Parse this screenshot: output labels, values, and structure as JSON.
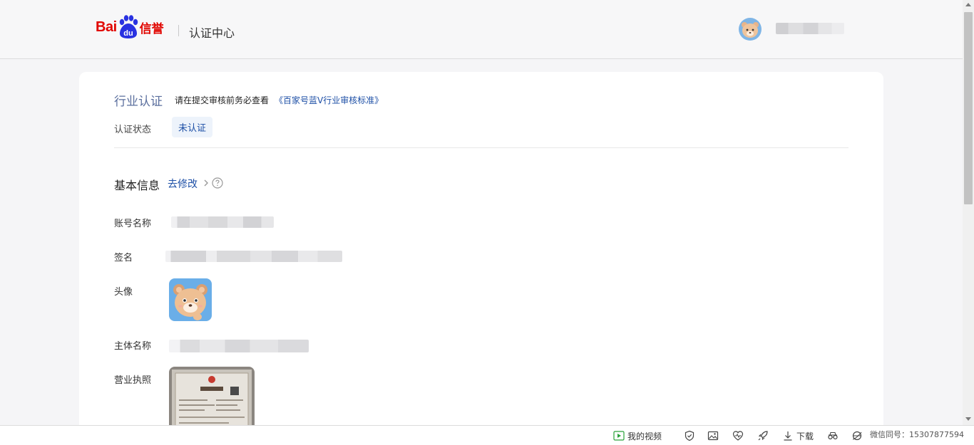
{
  "header": {
    "logo_bai": "Bai",
    "logo_du": "du",
    "logo_xinyu": "信誉",
    "title": "认证中心"
  },
  "industry": {
    "title": "行业认证",
    "note": "请在提交审核前务必查看",
    "link": "《百家号蓝V行业审核标准》",
    "status_label": "认证状态",
    "status_value": "未认证"
  },
  "basic": {
    "title": "基本信息",
    "edit_link": "去修改",
    "rows": {
      "account_name_label": "账号名称",
      "signature_label": "签名",
      "avatar_label": "头像",
      "subject_label": "主体名称",
      "license_label": "营业执照"
    }
  },
  "statusbar": {
    "my_video": "我的视频",
    "download": "下载",
    "watermark": "微信同号：15307877594"
  },
  "colors": {
    "brand_red": "#e10601",
    "link_blue": "#1d4fa6",
    "tag_bg": "#edf3fb"
  }
}
